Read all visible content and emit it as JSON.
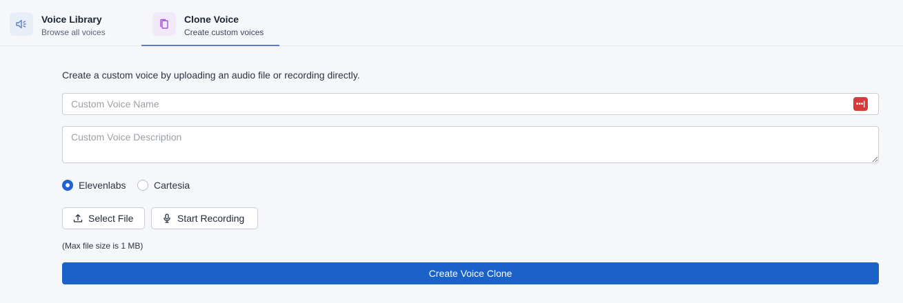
{
  "tabs": [
    {
      "title": "Voice Library",
      "subtitle": "Browse all voices",
      "icon": "speaker-icon",
      "active": false
    },
    {
      "title": "Clone Voice",
      "subtitle": "Create custom voices",
      "icon": "copy-icon",
      "active": true
    }
  ],
  "form": {
    "intro": "Create a custom voice by uploading an audio file or recording directly.",
    "name_placeholder": "Custom Voice Name",
    "name_value": "",
    "description_placeholder": "Custom Voice Description",
    "description_value": "",
    "password_manager_badge": "•••|",
    "providers": [
      {
        "label": "Elevenlabs",
        "selected": true
      },
      {
        "label": "Cartesia",
        "selected": false
      }
    ],
    "select_file_label": "Select File",
    "start_recording_label": "Start Recording",
    "file_size_note": "(Max file size is 1 MB)",
    "submit_label": "Create Voice Clone"
  },
  "colors": {
    "accent": "#1b62c8",
    "tab_underline": "#5b78d6",
    "radio_selected": "#2161d3",
    "badge": "#d93a3a",
    "background": "#f5f7fb"
  }
}
